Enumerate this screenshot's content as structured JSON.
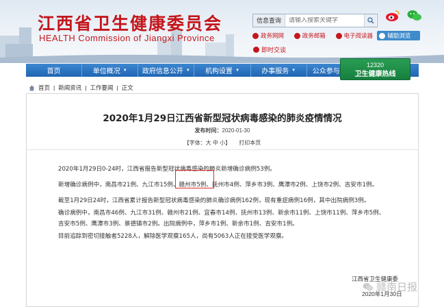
{
  "header": {
    "title_cn": "江西省卫生健康委员会",
    "title_en": "HEALTH Commission of Jiangxi Province",
    "search_label": "信息查询",
    "search_placeholder": "请输入搜索关键字",
    "quicklinks": [
      {
        "label": "政务网网",
        "boxed": false
      },
      {
        "label": "政务邮箱",
        "boxed": false
      },
      {
        "label": "电子阅读器",
        "boxed": false
      },
      {
        "label": "辅助浏览",
        "boxed": true
      }
    ],
    "mail_label": "即时交谈"
  },
  "nav": {
    "items": [
      "首页",
      "单位概况",
      "政府信息公开",
      "机构设置",
      "办事服务",
      "公众参与"
    ],
    "hotline_number": "12320",
    "hotline_label": "卫生健康热线"
  },
  "breadcrumb": [
    "首页",
    "新闻资讯",
    "工作要闻",
    "正文"
  ],
  "article": {
    "title": "2020年1月29日江西省新型冠状病毒感染的肺炎疫情情况",
    "date_label": "发布时间：",
    "date": "2020-01-30",
    "font_label": "【字体：大 中 小】",
    "print_label": "打印本页",
    "p1": "2020年1月29日0-24时，江西省报告新型冠状病毒感染的肺炎新增确诊病例53例。",
    "p2": "新增确诊病例中，南昌市21例、九江市15例、赣州市5例、抚州市4例、萍乡市3例、鹰潭市2例、上饶市2例、吉安市1例。",
    "p3": "截至1月29日24时，江西省累计报告新型冠状病毒感染的肺炎确诊病例162例，现有重症病例16例，其中出院病例3例。",
    "p4a": "确诊病例中，南昌市46例、九江市31例、赣州市21例、宜春市14例、抚州市13例、新余市11例、上饶市11例、萍乡市5例、",
    "p4b": "吉安市5例、鹰潭市3例、景德镇市2例。出院病例中，萍乡市1例、新余市1例、吉安市1例。",
    "p5": "目前追踪到密切接触者5228人，解除医学观察165人，尚有5063人正在接受医学观察。",
    "signature": "江西省卫生健康委",
    "signature_date": "2020年1月30日"
  },
  "watermark": "赣南日报",
  "colors": {
    "brand_red": "#c4161c",
    "nav_blue": "#2a74c2",
    "hotline_green": "#1f8f49",
    "highlight_red": "#e02828"
  }
}
